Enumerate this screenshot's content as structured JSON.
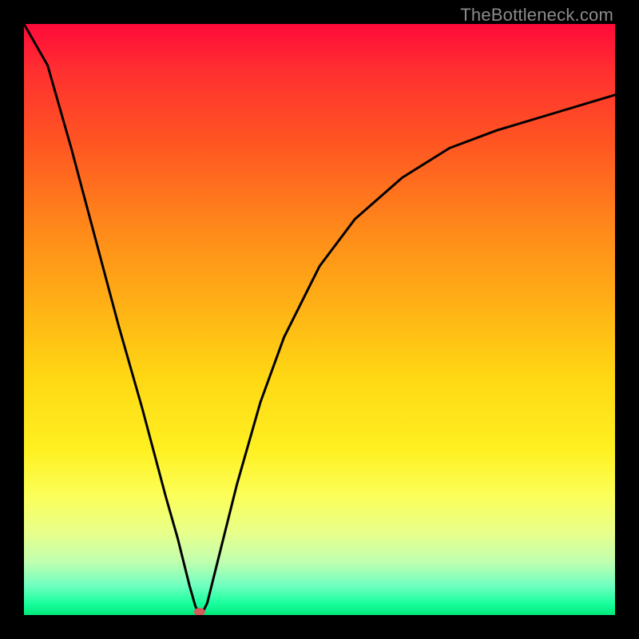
{
  "watermark": "TheBottleneck.com",
  "chart_data": {
    "type": "line",
    "title": "",
    "xlabel": "",
    "ylabel": "",
    "xlim": [
      0,
      100
    ],
    "ylim": [
      0,
      100
    ],
    "background": "vertical-gradient red→orange→yellow→green",
    "series": [
      {
        "name": "bottleneck-curve",
        "x": [
          0,
          4,
          8,
          12,
          16,
          20,
          24,
          26,
          28,
          29,
          29.5,
          30,
          31,
          32,
          34,
          36,
          40,
          44,
          50,
          56,
          64,
          72,
          80,
          90,
          100
        ],
        "y": [
          108,
          93,
          79,
          64,
          49,
          35,
          20,
          13,
          5,
          1.5,
          0.5,
          0,
          2,
          6,
          14,
          22,
          36,
          47,
          59,
          67,
          74,
          79,
          82,
          85,
          88
        ]
      }
    ],
    "marker": {
      "x": 29.7,
      "y": 0,
      "color": "#d55a5a",
      "radius": 6
    }
  }
}
